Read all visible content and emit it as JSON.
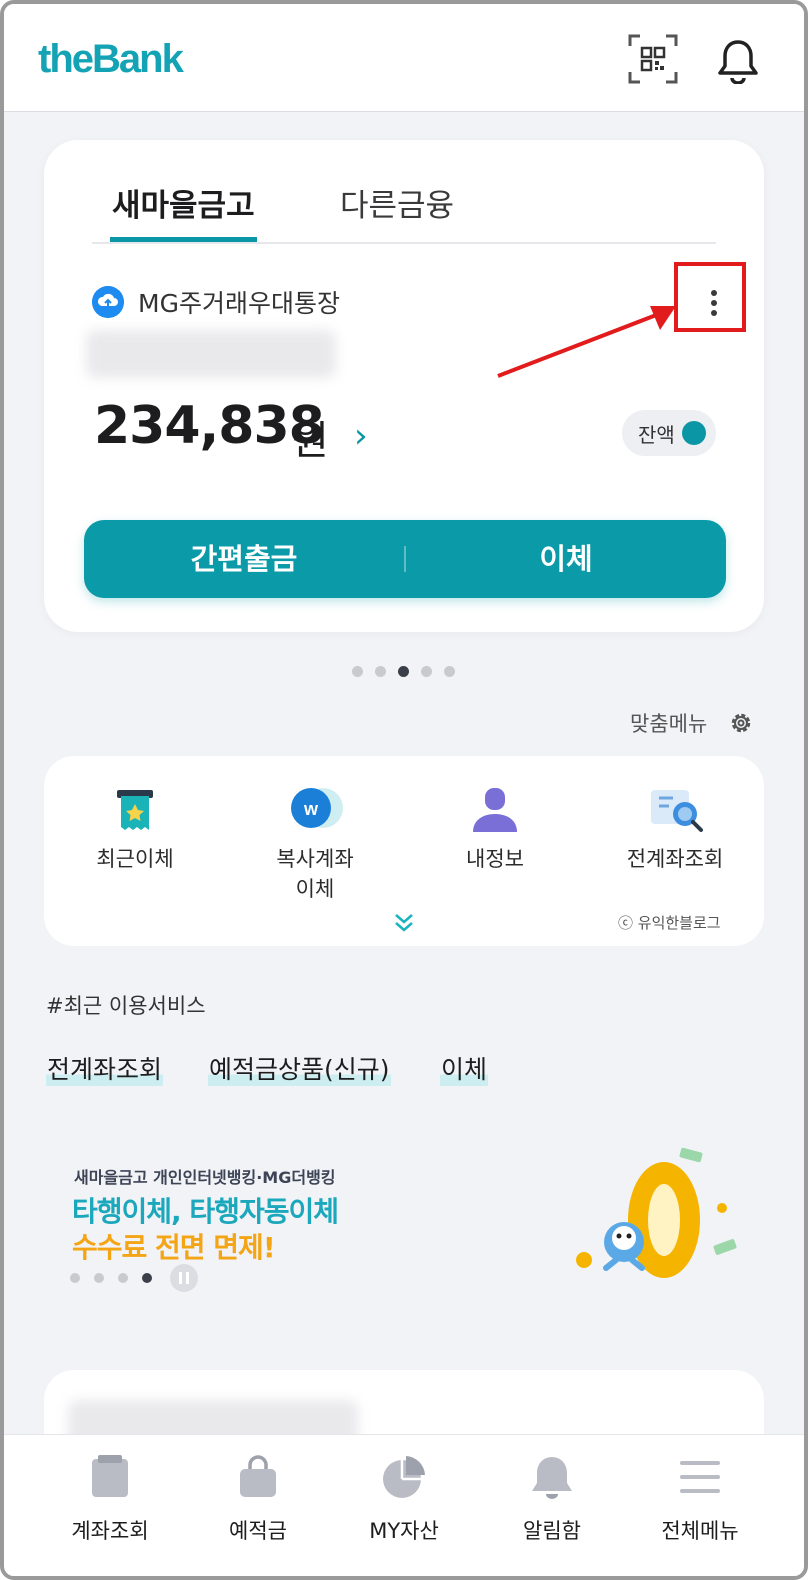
{
  "header": {
    "logo_text": "theBank",
    "qr_icon": "qr-scan-icon",
    "bell_icon": "bell-icon"
  },
  "account_card": {
    "tabs": [
      {
        "label": "새마을금고",
        "active": true
      },
      {
        "label": "다른금융",
        "active": false
      }
    ],
    "account_name": "MG주거래우대통장",
    "account_icon": "cloud-upload-icon",
    "balance_amount": "234,838",
    "balance_unit": "원",
    "balance_toggle_label": "잔액",
    "balance_toggle_on": true,
    "actions": {
      "left_label": "간편출금",
      "right_label": "이체"
    }
  },
  "pager": {
    "count": 5,
    "active_index": 2
  },
  "custom_menu_label": "맞춤메뉴",
  "quick_menu": {
    "items": [
      {
        "label": "최근이체",
        "icon": "receipt-star-icon"
      },
      {
        "label": "복사계좌\n이체",
        "icon": "copy-account-icon"
      },
      {
        "label": "내정보",
        "icon": "person-icon"
      },
      {
        "label": "전계좌조회",
        "icon": "account-search-icon"
      }
    ],
    "watermark": "ⓒ 유익한블로그"
  },
  "recent": {
    "title": "#최근 이용서비스",
    "links": [
      "전계좌조회",
      "예적금상품(신규)",
      "이체"
    ]
  },
  "banner": {
    "subtitle": "새마을금고 개인인터넷뱅킹·MG더뱅킹",
    "line1": "타행이체, 타행자동이체",
    "line2": "수수료 전면 면제!",
    "dots": 4,
    "active_dot": 3
  },
  "bottom_nav": {
    "items": [
      {
        "label": "계좌조회",
        "icon": "account-book-icon"
      },
      {
        "label": "예적금",
        "icon": "shopping-bag-icon"
      },
      {
        "label": "MY자산",
        "icon": "pie-chart-icon"
      },
      {
        "label": "알림함",
        "icon": "bell-icon"
      },
      {
        "label": "전체메뉴",
        "icon": "hamburger-menu-icon"
      }
    ]
  },
  "colors": {
    "accent": "#0a9aa8",
    "highlight_box": "#e21c1c",
    "banner_blue": "#1ba7bc",
    "banner_orange": "#f4a515"
  }
}
